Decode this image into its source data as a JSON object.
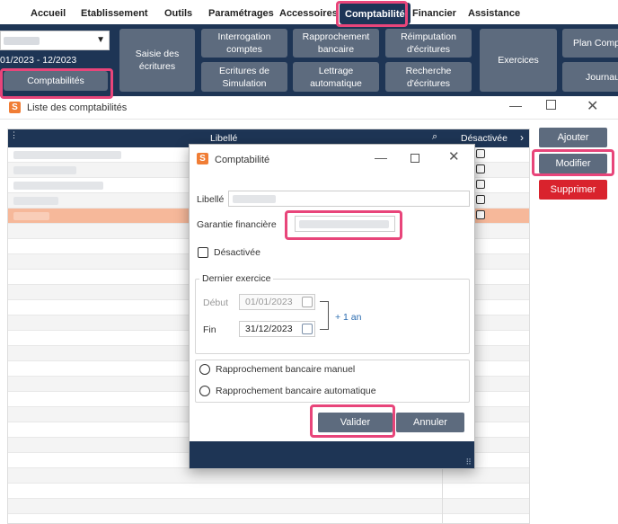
{
  "menu": {
    "items": [
      {
        "label": "Accueil"
      },
      {
        "label": "Etablissement"
      },
      {
        "label": "Outils"
      },
      {
        "label": "Paramétrages"
      },
      {
        "label": "Accessoires"
      },
      {
        "label": "Comptabilité"
      },
      {
        "label": "Financier"
      },
      {
        "label": "Assistance"
      }
    ],
    "active": "Comptabilité"
  },
  "ribbon": {
    "period": "01/2023 - 12/2023",
    "comptabilites": "Comptabilités",
    "saisie": "Saisie des écritures",
    "interrogation": "Interrogation comptes",
    "ecritures_sim": "Ecritures de Simulation",
    "rapprochement": "Rapprochement bancaire",
    "lettrage": "Lettrage automatique",
    "reimputation": "Réimputation d'écritures",
    "recherche": "Recherche d'écritures",
    "exercices": "Exercices",
    "plan_comptable": "Plan Compt",
    "journaux": "Journau"
  },
  "window": {
    "title": "Liste des comptabilités",
    "col_libelle": "Libellé",
    "col_desactivee": "Désactivée",
    "ajouter": "Ajouter",
    "modifier": "Modifier",
    "supprimer": "Supprimer"
  },
  "dialog": {
    "title": "Comptabilité",
    "libelle_label": "Libellé",
    "garantie_label": "Garantie financière",
    "desactivee_label": "Désactivée",
    "dernier_exercice": "Dernier exercice",
    "debut_label": "Début",
    "debut_value": "01/01/2023",
    "fin_label": "Fin",
    "fin_value": "31/12/2023",
    "plus_un_an": "+ 1 an",
    "radio_manuel": "Rapprochement bancaire manuel",
    "radio_auto": "Rapprochement bancaire automatique",
    "valider": "Valider",
    "annuler": "Annuler"
  },
  "colors": {
    "navy": "#1e3555",
    "ribbon_button": "#5d6b7e",
    "selected_row": "#f6b89a",
    "delete_red": "#d9232d",
    "highlight_pink": "#e8457a",
    "logo_orange": "#f07d35"
  }
}
